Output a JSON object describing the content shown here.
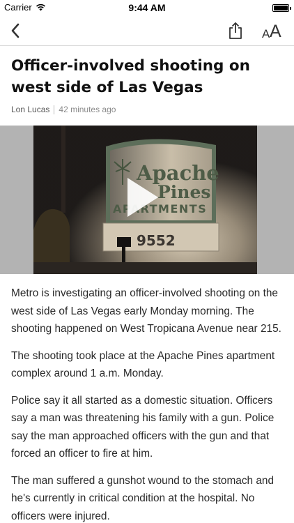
{
  "status_bar": {
    "carrier": "Carrier",
    "time": "9:44 AM"
  },
  "nav": {
    "back_icon": "chevron-left-icon",
    "share_icon": "share-icon",
    "font_size_small": "A",
    "font_size_large": "A"
  },
  "article": {
    "headline": "Officer-involved shooting on west side of Las Vegas",
    "author": "Lon Lucas",
    "time_ago": "42 minutes ago",
    "video": {
      "sign_line1": "Apache",
      "sign_line2": "Pines",
      "sign_line3": "APARTMENTS",
      "address_number": "9552"
    },
    "paragraphs": [
      "Metro is investigating an officer-involved shooting on the west side of Las Vegas early Monday morning. The shooting happened on West Tropicana Avenue near 215.",
      "The shooting took place at the Apache Pines apartment complex around 1 a.m. Monday.",
      "Police say it all started as a domestic situation. Officers say a man was threatening his family with a gun. Police say the man approached officers with the gun and that forced an officer to fire at him.",
      "The man suffered a gunshot wound to the stomach and he's currently in critical condition at the hospital. No officers were injured."
    ]
  },
  "colors": {
    "accent": "#333333",
    "video_side": "#b3b3b3",
    "divider": "#d8d8d8"
  }
}
